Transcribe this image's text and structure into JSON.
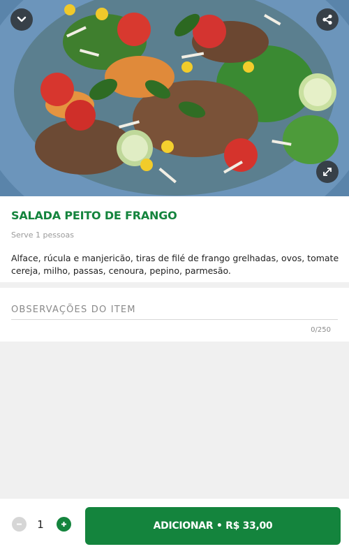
{
  "product": {
    "title": "SALADA PEITO DE FRANGO",
    "serves": "Serve 1 pessoas",
    "description": "Alface, rúcula e manjericão, tiras de filé de frango grelhadas, ovos, tomate cereja, milho, passas, cenoura, pepino, parmesão."
  },
  "icons": {
    "collapse": "chevron-down-icon",
    "share": "share-icon",
    "expand": "expand-icon",
    "minus": "minus-icon",
    "plus": "plus-icon"
  },
  "notes": {
    "label": "OBSERVAÇÕES DO ITEM",
    "counter": "0/250"
  },
  "cart": {
    "quantity": "1",
    "add_label": "ADICIONAR • R$ 33,00"
  },
  "colors": {
    "brand": "#14843d",
    "background": "#f0f0f0"
  }
}
